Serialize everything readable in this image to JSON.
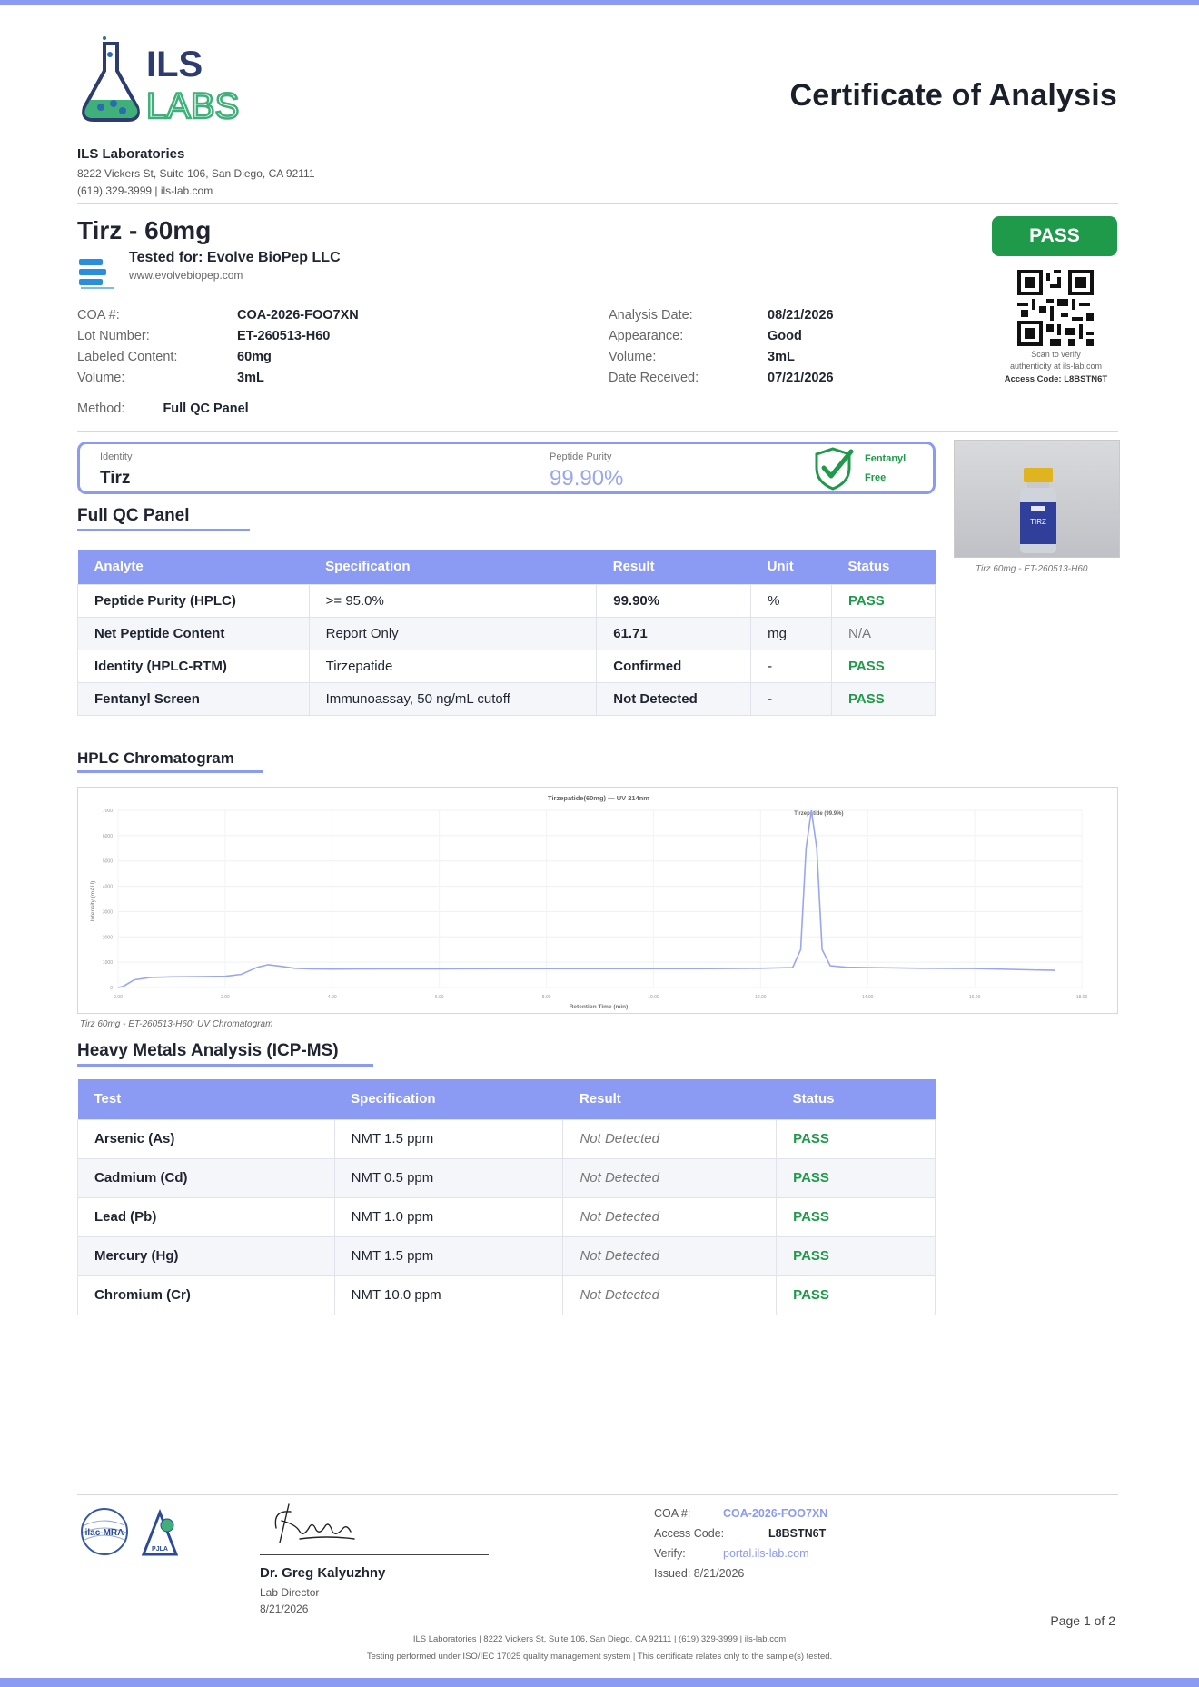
{
  "brand": {
    "logo_text_top": "ILS",
    "logo_text_bottom": "LABS",
    "accent_color": "#8b9af3",
    "pass_color": "#1f9a4a"
  },
  "header": {
    "document_title": "Certificate of Analysis",
    "lab_name": "ILS Laboratories",
    "lab_address": "8222 Vickers St, Suite 106, San Diego, CA 92111",
    "lab_contact": "(619) 329-3999  |  ils-lab.com"
  },
  "product": {
    "title": "Tirz - 60mg",
    "tested_for": "Tested for: Evolve BioPep LLC",
    "client_url": "www.evolvebiopep.com",
    "overall_status": "PASS"
  },
  "details_left": [
    {
      "label": "COA #:",
      "value": "COA-2026-FOO7XN"
    },
    {
      "label": "Lot Number:",
      "value": "ET-260513-H60"
    },
    {
      "label": "Labeled Content:",
      "value": "60mg"
    },
    {
      "label": "Volume:",
      "value": "3mL"
    }
  ],
  "details_right": [
    {
      "label": "Analysis Date:",
      "value": "08/21/2026"
    },
    {
      "label": "Appearance:",
      "value": "Good"
    },
    {
      "label": "Volume:",
      "value": "3mL"
    },
    {
      "label": "Date Received:",
      "value": "07/21/2026"
    }
  ],
  "method": {
    "label": "Method:",
    "value": "Full QC Panel"
  },
  "qr": {
    "note_line1": "Scan to verify",
    "note_line2": "authenticity at ils-lab.com",
    "access_code": "Access Code: L8BSTN6T"
  },
  "summary": {
    "identity_label": "Identity",
    "identity_value": "Tirz",
    "purity_label": "Peptide Purity",
    "purity_value": "99.90%",
    "fentanyl_line1": "Fentanyl",
    "fentanyl_line2": "Free"
  },
  "vial": {
    "label_line1": "TIRZ",
    "caption": "Tirz 60mg - ET-260513-H60"
  },
  "qc_panel": {
    "title": "Full QC Panel",
    "headers": [
      "Analyte",
      "Specification",
      "Result",
      "Unit",
      "Status"
    ],
    "rows": [
      [
        "Peptide Purity (HPLC)",
        ">= 95.0%",
        "99.90%",
        "%",
        "PASS"
      ],
      [
        "Net Peptide Content",
        "Report Only",
        "61.71",
        "mg",
        "N/A"
      ],
      [
        "Identity (HPLC-RTM)",
        "Tirzepatide",
        "Confirmed",
        "-",
        "PASS"
      ],
      [
        "Fentanyl Screen",
        "Immunoassay, 50 ng/mL cutoff",
        "Not Detected",
        "-",
        "PASS"
      ]
    ]
  },
  "hplc": {
    "title": "HPLC Chromatogram",
    "caption": "Tirz 60mg - ET-260513-H60: UV Chromatogram"
  },
  "chart_data": {
    "type": "line",
    "title": "Tirzepatide(60mg) — UV 214nm",
    "xlabel": "Retention Time (min)",
    "ylabel": "Intensity (mAU)",
    "annotation": "Tirzepatide (99.9%)",
    "xlim": [
      0,
      18
    ],
    "ylim": [
      0,
      7000
    ],
    "grid": true,
    "series": [
      {
        "color": "#9aa6f0",
        "x": [
          0,
          0.1,
          0.3,
          0.6,
          1.0,
          1.5,
          2.0,
          2.3,
          2.6,
          2.8,
          3.0,
          3.3,
          3.6,
          4.0,
          5.0,
          6.0,
          7.0,
          8.0,
          9.0,
          10.0,
          11.0,
          12.0,
          12.6,
          12.75,
          12.85,
          12.95,
          13.05,
          13.15,
          13.3,
          13.6,
          14.0,
          15.0,
          16.0,
          17.0,
          17.5
        ],
        "y": [
          0,
          50,
          300,
          400,
          420,
          430,
          440,
          520,
          800,
          900,
          850,
          760,
          740,
          730,
          740,
          740,
          745,
          745,
          745,
          745,
          745,
          760,
          790,
          1500,
          5500,
          7000,
          5500,
          1500,
          860,
          800,
          790,
          760,
          750,
          700,
          680
        ]
      }
    ]
  },
  "heavy_metals": {
    "title": "Heavy Metals Analysis (ICP-MS)",
    "headers": [
      "Test",
      "Specification",
      "Result",
      "Status"
    ],
    "rows": [
      [
        "Arsenic (As)",
        "NMT 1.5 ppm",
        "Not Detected",
        "PASS"
      ],
      [
        "Cadmium (Cd)",
        "NMT 0.5 ppm",
        "Not Detected",
        "PASS"
      ],
      [
        "Lead (Pb)",
        "NMT 1.0 ppm",
        "Not Detected",
        "PASS"
      ],
      [
        "Mercury (Hg)",
        "NMT 1.5 ppm",
        "Not Detected",
        "PASS"
      ],
      [
        "Chromium (Cr)",
        "NMT 10.0 ppm",
        "Not Detected",
        "PASS"
      ]
    ]
  },
  "footer": {
    "accreditation_1": "ilac-MRA",
    "accreditation_2": "PJLA",
    "signer_name": "Dr. Greg Kalyuzhny",
    "signer_role": "Lab Director",
    "signed_date": "8/21/2026",
    "coa_label": "COA #:",
    "coa_value": "COA-2026-FOO7XN",
    "access_label": "Access Code:",
    "access_value": "L8BSTN6T",
    "verify_label": "Verify:",
    "verify_value": "portal.ils-lab.com",
    "issued": "Issued: 8/21/2026",
    "page": "Page 1 of 2",
    "line1": "ILS Laboratories  |  8222 Vickers St, Suite 106, San Diego, CA 92111  |  (619) 329-3999  |  ils-lab.com",
    "line2": "Testing performed under ISO/IEC 17025 quality management system  |  This certificate relates only to the sample(s) tested."
  }
}
